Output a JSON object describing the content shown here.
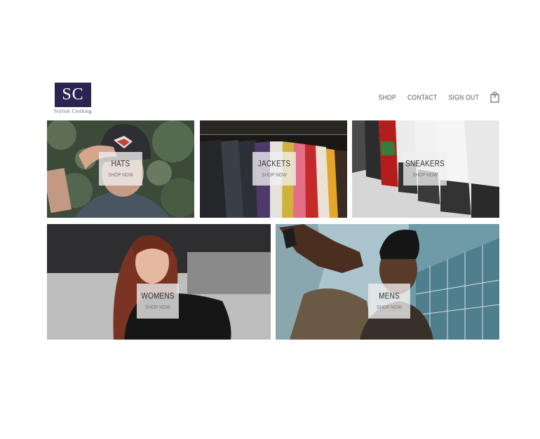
{
  "brand": {
    "logo_text": "SC",
    "name": "Stylish Clothing"
  },
  "nav": {
    "items": [
      {
        "label": "SHOP"
      },
      {
        "label": "CONTACT"
      },
      {
        "label": "SIGN OUT"
      }
    ],
    "cart_count": "0"
  },
  "categories": [
    {
      "title": "HATS",
      "cta": "SHOP NOW"
    },
    {
      "title": "JACKETS",
      "cta": "SHOP NOW"
    },
    {
      "title": "SNEAKERS",
      "cta": "SHOP NOW"
    },
    {
      "title": "WOMENS",
      "cta": "SHOP NOW"
    },
    {
      "title": "MENS",
      "cta": "SHOP NOW"
    }
  ]
}
